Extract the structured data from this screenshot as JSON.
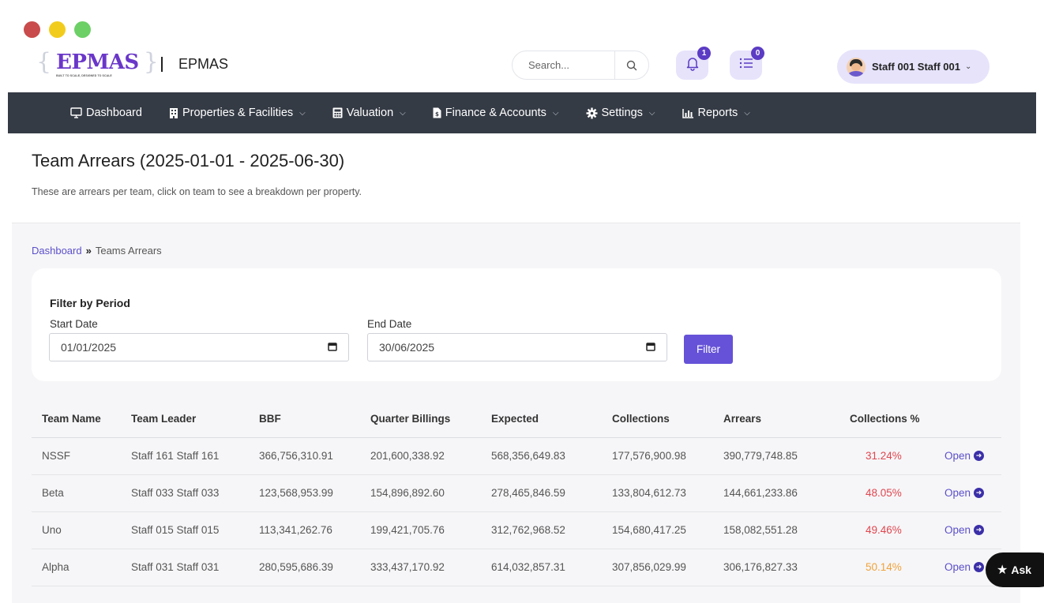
{
  "header": {
    "logo_text": "EPMAS",
    "logo_tagline": "BUILT TO SCALE, DESIGNED TO SCALE",
    "app_name": "EPMAS",
    "search_placeholder": "Search...",
    "notifications_count": "1",
    "tasks_count": "0",
    "user_name": "Staff 001 Staff 001"
  },
  "nav": {
    "items": [
      {
        "label": "Dashboard",
        "icon": "monitor-icon",
        "has_caret": false
      },
      {
        "label": "Properties & Facilities",
        "icon": "building-icon",
        "has_caret": true
      },
      {
        "label": "Valuation",
        "icon": "calculator-icon",
        "has_caret": true
      },
      {
        "label": "Finance & Accounts",
        "icon": "file-invoice-icon",
        "has_caret": true
      },
      {
        "label": "Settings",
        "icon": "gear-icon",
        "has_caret": true
      },
      {
        "label": "Reports",
        "icon": "chart-icon",
        "has_caret": true
      }
    ]
  },
  "page": {
    "title": "Team Arrears (2025-01-01 - 2025-06-30)",
    "subtitle": "These are arrears per team, click on team to see a breakdown per property.",
    "breadcrumb": {
      "home": "Dashboard",
      "separator": "»",
      "current": "Teams Arrears"
    }
  },
  "filter": {
    "title": "Filter by Period",
    "start_label": "Start Date",
    "start_value": "01/01/2025",
    "end_label": "End Date",
    "end_value": "30/06/2025",
    "button_label": "Filter"
  },
  "table": {
    "columns": [
      "Team Name",
      "Team Leader",
      "BBF",
      "Quarter Billings",
      "Expected",
      "Collections",
      "Arrears",
      "Collections %",
      ""
    ],
    "open_label": "Open",
    "rows": [
      {
        "team": "NSSF",
        "leader": "Staff 161 Staff 161",
        "bbf": "366,756,310.91",
        "billings": "201,600,338.92",
        "expected": "568,356,649.83",
        "collections": "177,576,900.98",
        "arrears": "390,779,748.85",
        "pct": "31.24%",
        "pct_color": "red"
      },
      {
        "team": "Beta",
        "leader": "Staff 033 Staff 033",
        "bbf": "123,568,953.99",
        "billings": "154,896,892.60",
        "expected": "278,465,846.59",
        "collections": "133,804,612.73",
        "arrears": "144,661,233.86",
        "pct": "48.05%",
        "pct_color": "red"
      },
      {
        "team": "Uno",
        "leader": "Staff 015 Staff 015",
        "bbf": "113,341,262.76",
        "billings": "199,421,705.76",
        "expected": "312,762,968.52",
        "collections": "154,680,417.25",
        "arrears": "158,082,551.28",
        "pct": "49.46%",
        "pct_color": "red"
      },
      {
        "team": "Alpha",
        "leader": "Staff 031 Staff 031",
        "bbf": "280,595,686.39",
        "billings": "333,437,170.92",
        "expected": "614,032,857.31",
        "collections": "307,856,029.99",
        "arrears": "306,176,827.33",
        "pct": "50.14%",
        "pct_color": "orange"
      }
    ]
  },
  "ask_button": {
    "label": "Ask"
  },
  "colors": {
    "accent": "#6552d8",
    "nav_bg": "#353b45",
    "pct_red": "#e0464f",
    "pct_orange": "#f0a23a"
  }
}
